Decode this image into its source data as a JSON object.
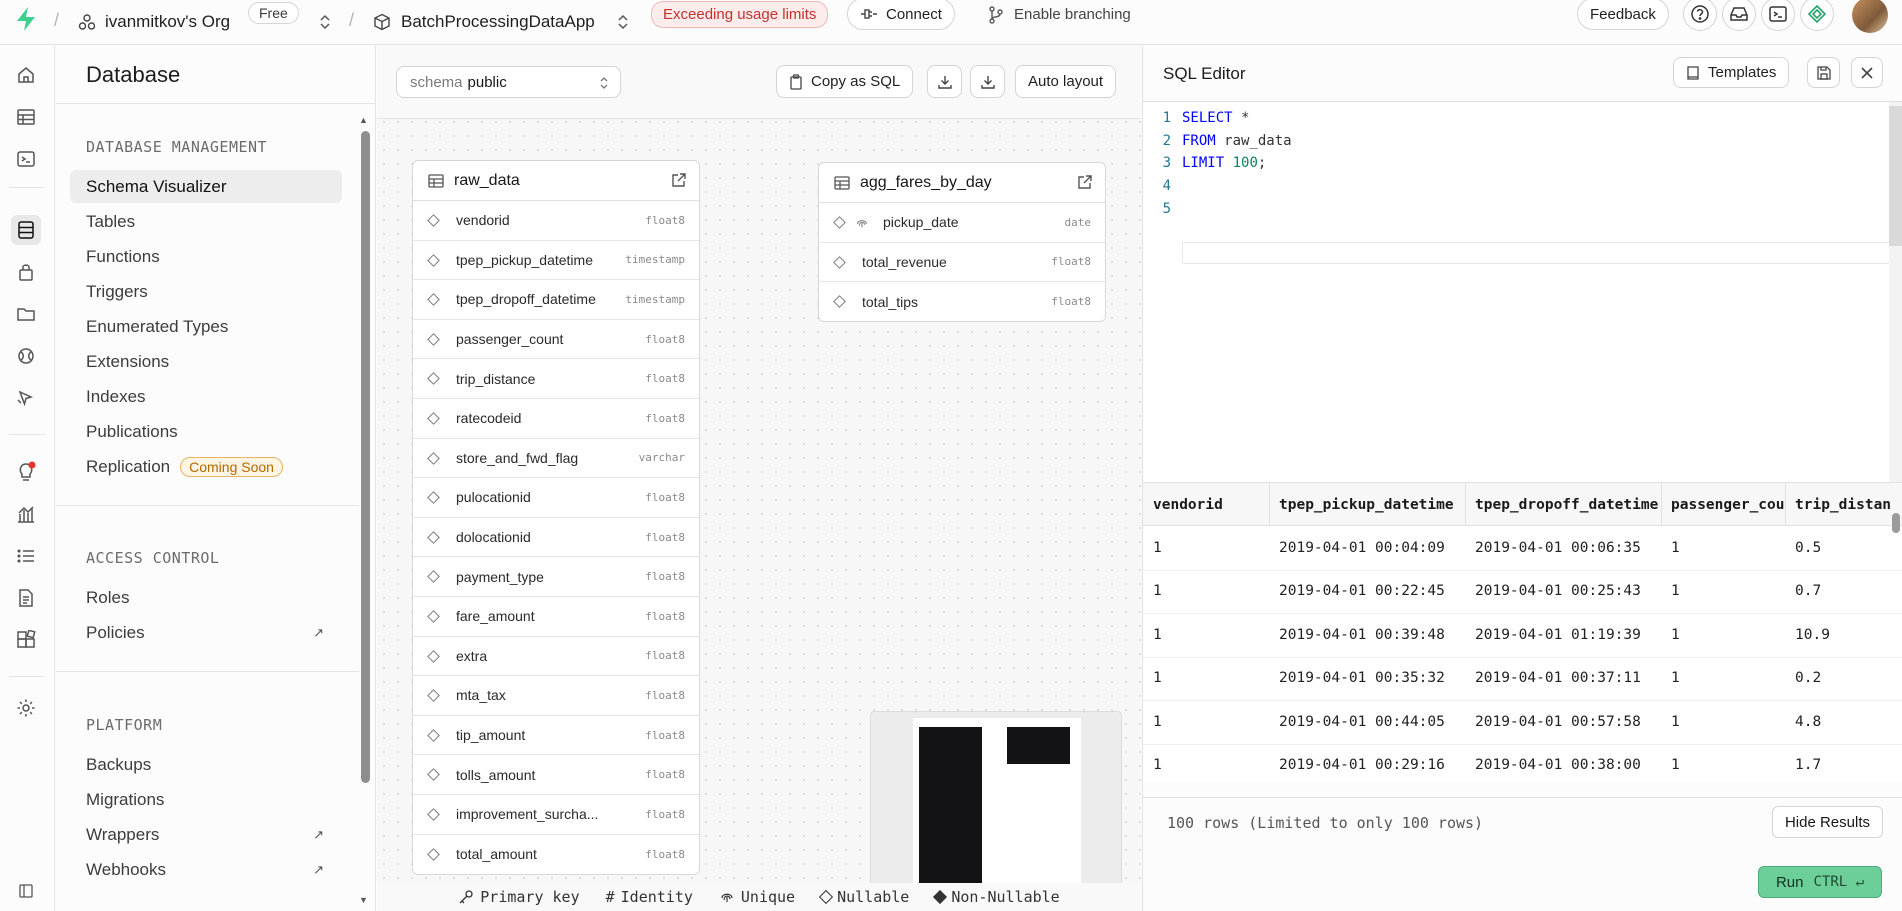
{
  "topbar": {
    "org_name": "ivanmitkov's Org",
    "plan": "Free",
    "project_name": "BatchProcessingDataApp",
    "usage_warning": "Exceeding usage limits",
    "connect": "Connect",
    "branching": "Enable branching",
    "feedback": "Feedback"
  },
  "menu": {
    "title": "Database",
    "sections": [
      {
        "title": "DATABASE MANAGEMENT",
        "items": [
          "Schema Visualizer",
          "Tables",
          "Functions",
          "Triggers",
          "Enumerated Types",
          "Extensions",
          "Indexes",
          "Publications",
          "Replication"
        ]
      },
      {
        "title": "ACCESS CONTROL",
        "items": [
          "Roles",
          "Policies"
        ]
      },
      {
        "title": "PLATFORM",
        "items": [
          "Backups",
          "Migrations",
          "Wrappers",
          "Webhooks"
        ]
      }
    ],
    "coming_soon": "Coming Soon"
  },
  "canvas": {
    "schema_label": "schema",
    "schema_value": "public",
    "copy_sql": "Copy as SQL",
    "auto_layout": "Auto layout",
    "tables": [
      {
        "name": "raw_data",
        "columns": [
          {
            "name": "vendorid",
            "type": "float8"
          },
          {
            "name": "tpep_pickup_datetime",
            "type": "timestamp"
          },
          {
            "name": "tpep_dropoff_datetime",
            "type": "timestamp"
          },
          {
            "name": "passenger_count",
            "type": "float8"
          },
          {
            "name": "trip_distance",
            "type": "float8"
          },
          {
            "name": "ratecodeid",
            "type": "float8"
          },
          {
            "name": "store_and_fwd_flag",
            "type": "varchar"
          },
          {
            "name": "pulocationid",
            "type": "float8"
          },
          {
            "name": "dolocationid",
            "type": "float8"
          },
          {
            "name": "payment_type",
            "type": "float8"
          },
          {
            "name": "fare_amount",
            "type": "float8"
          },
          {
            "name": "extra",
            "type": "float8"
          },
          {
            "name": "mta_tax",
            "type": "float8"
          },
          {
            "name": "tip_amount",
            "type": "float8"
          },
          {
            "name": "tolls_amount",
            "type": "float8"
          },
          {
            "name": "improvement_surcha...",
            "type": "float8"
          },
          {
            "name": "total_amount",
            "type": "float8"
          }
        ]
      },
      {
        "name": "agg_fares_by_day",
        "columns": [
          {
            "name": "pickup_date",
            "type": "date"
          },
          {
            "name": "total_revenue",
            "type": "float8"
          },
          {
            "name": "total_tips",
            "type": "float8"
          }
        ]
      }
    ],
    "legend": [
      "Primary key",
      "Identity",
      "Unique",
      "Nullable",
      "Non-Nullable"
    ]
  },
  "sql": {
    "title": "SQL Editor",
    "templates": "Templates",
    "line_numbers": [
      "1",
      "2",
      "3",
      "4",
      "5"
    ],
    "results": {
      "columns": [
        "vendorid",
        "tpep_pickup_datetime",
        "tpep_dropoff_datetime",
        "passenger_cou",
        "trip_distan"
      ],
      "rows": [
        [
          "1",
          "2019-04-01 00:04:09",
          "2019-04-01 00:06:35",
          "1",
          "0.5"
        ],
        [
          "1",
          "2019-04-01 00:22:45",
          "2019-04-01 00:25:43",
          "1",
          "0.7"
        ],
        [
          "1",
          "2019-04-01 00:39:48",
          "2019-04-01 01:19:39",
          "1",
          "10.9"
        ],
        [
          "1",
          "2019-04-01 00:35:32",
          "2019-04-01 00:37:11",
          "1",
          "0.2"
        ],
        [
          "1",
          "2019-04-01 00:44:05",
          "2019-04-01 00:57:58",
          "1",
          "4.8"
        ],
        [
          "1",
          "2019-04-01 00:29:16",
          "2019-04-01 00:38:00",
          "1",
          "1.7"
        ]
      ]
    },
    "rows_info": "100 rows (Limited to only 100 rows)",
    "hide_results": "Hide Results",
    "run": "Run",
    "run_shortcut": "CTRL ↵"
  }
}
